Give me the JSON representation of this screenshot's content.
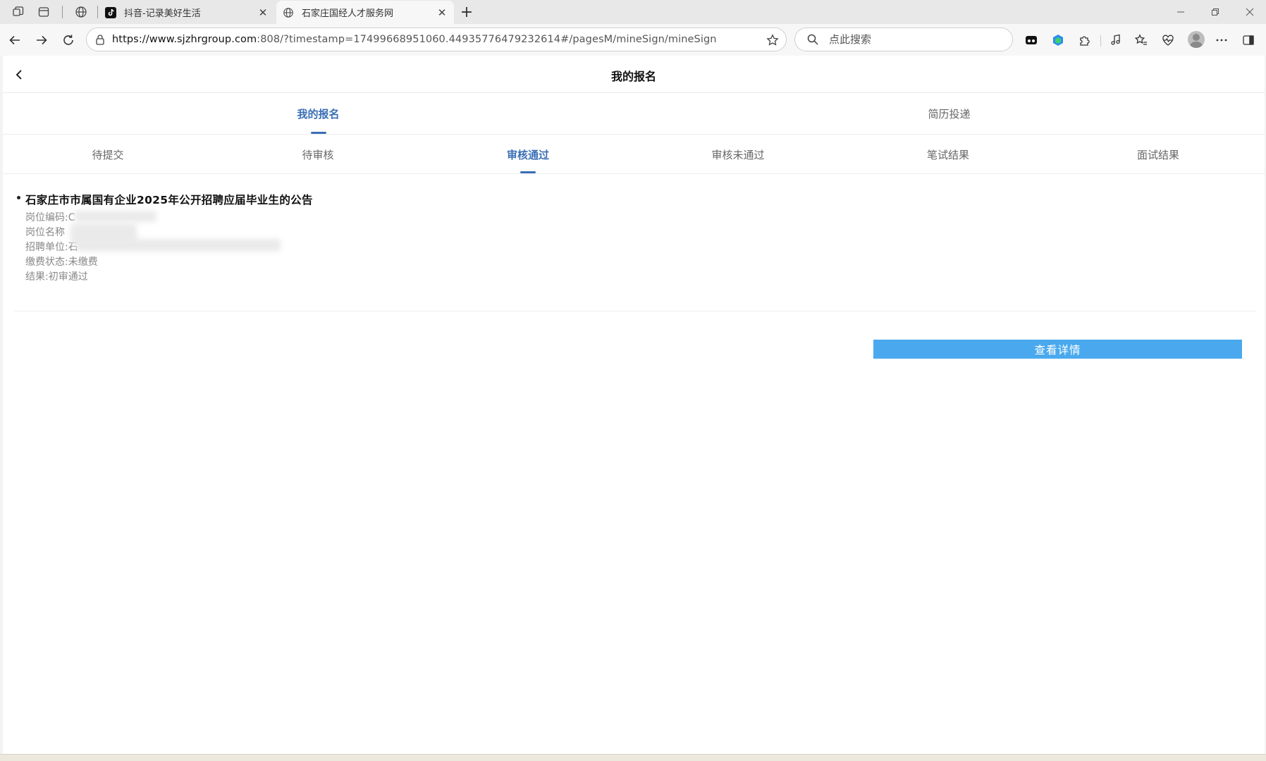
{
  "browser": {
    "tabs": [
      {
        "title": "抖音-记录美好生活",
        "icon": "tiktok-icon"
      },
      {
        "title": "石家庄国经人才服务网",
        "icon": "globe-icon"
      }
    ],
    "address": {
      "host": "https://www.sjzhrgroup.com",
      "rest": ":808/?timestamp=17499668951060.44935776479232614#/pagesM/mineSign/mineSign"
    },
    "search_placeholder": "点此搜索"
  },
  "page": {
    "title": "我的报名",
    "main_tabs": [
      {
        "label": "我的报名",
        "selected": true
      },
      {
        "label": "简历投递",
        "selected": false
      }
    ],
    "sub_tabs": [
      {
        "label": "待提交",
        "selected": false
      },
      {
        "label": "待审核",
        "selected": false
      },
      {
        "label": "审核通过",
        "selected": true
      },
      {
        "label": "审核未通过",
        "selected": false
      },
      {
        "label": "笔试结果",
        "selected": false
      },
      {
        "label": "面试结果",
        "selected": false
      }
    ],
    "record": {
      "title": "石家庄市市属国有企业2025年公开招聘应届毕业生的公告",
      "position_code": "岗位编码:C",
      "position_name": "岗位名称",
      "employer": "招聘单位:石",
      "payment_status": "缴费状态:未缴费",
      "result": "结果:初审通过",
      "detail_button": "查看详情"
    }
  },
  "colors": {
    "accent": "#3a6fb5",
    "button": "#4aa9ee"
  }
}
